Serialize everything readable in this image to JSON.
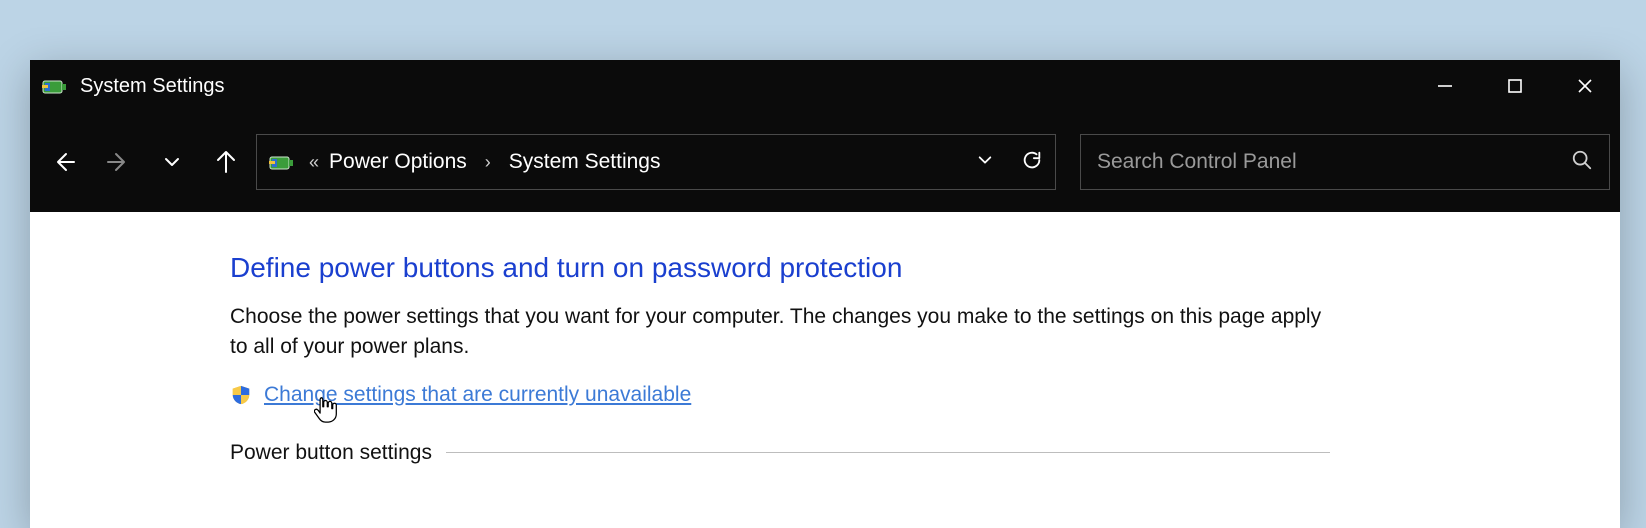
{
  "window": {
    "title": "System Settings"
  },
  "breadcrumb": {
    "item1": "Power Options",
    "item2": "System Settings"
  },
  "search": {
    "placeholder": "Search Control Panel"
  },
  "content": {
    "heading": "Define power buttons and turn on password protection",
    "description": "Choose the power settings that you want for your computer. The changes you make to the settings on this page apply to all of your power plans.",
    "admin_link": "Change settings that are currently unavailable",
    "section1": "Power button settings"
  }
}
